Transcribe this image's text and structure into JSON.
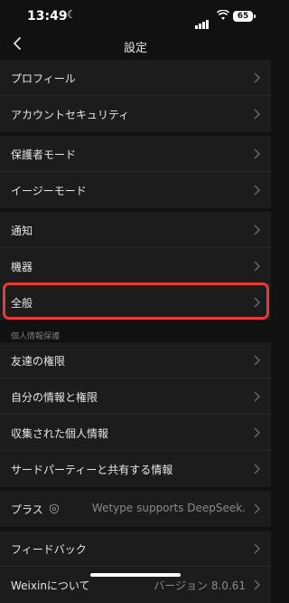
{
  "status_bar": {
    "time": "13:49",
    "battery": "65"
  },
  "nav": {
    "title": "設定"
  },
  "group1": [
    {
      "label": "プロフィール"
    },
    {
      "label": "アカウントセキュリティ"
    }
  ],
  "group2": [
    {
      "label": "保護者モード"
    },
    {
      "label": "イージーモード"
    }
  ],
  "group3": [
    {
      "label": "通知"
    },
    {
      "label": "機器"
    },
    {
      "label": "全般"
    }
  ],
  "privacy_section": {
    "header": "個人情報保護",
    "items": [
      {
        "label": "友達の権限"
      },
      {
        "label": "自分の情報と権限"
      },
      {
        "label": "収集された個人情報"
      },
      {
        "label": "サードパーティーと共有する情報"
      }
    ]
  },
  "plus": {
    "label": "プラス",
    "value": "Wetype supports DeepSeek."
  },
  "feedback": {
    "label": "フィードバック"
  },
  "about": {
    "label": "Weixinについて",
    "value": "バージョン 8.0.61"
  },
  "colors": {
    "background": "#111111",
    "row": "#1c1c1c",
    "highlight": "#e53b3b"
  }
}
